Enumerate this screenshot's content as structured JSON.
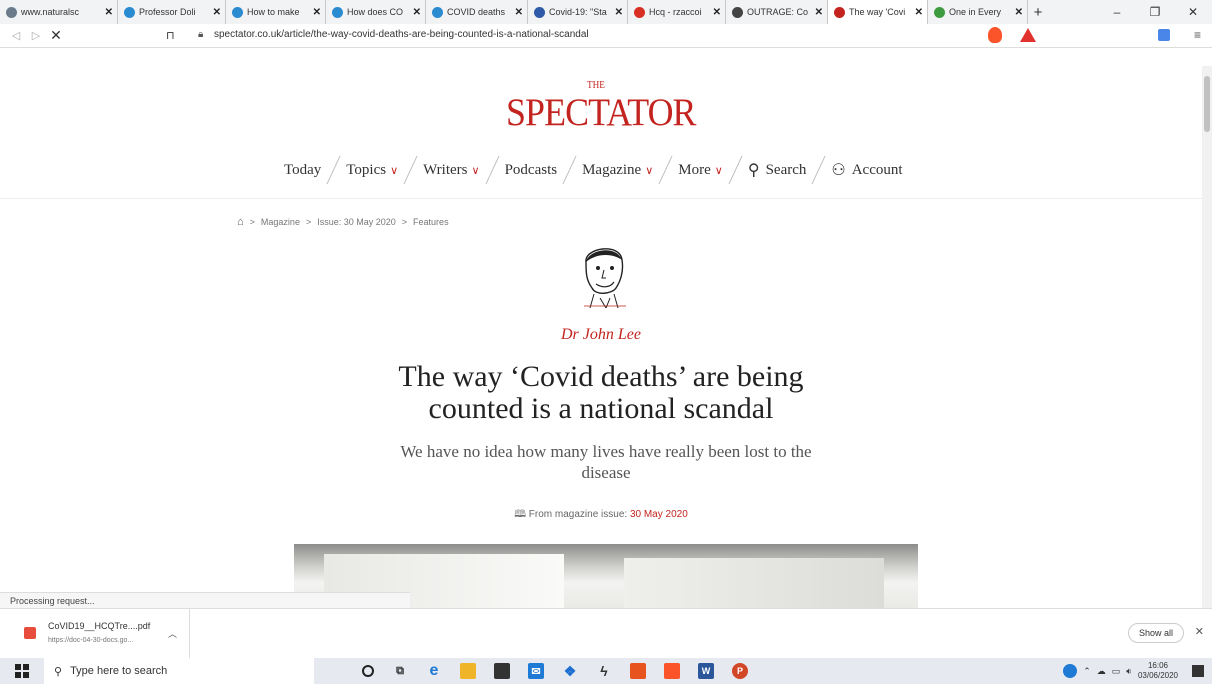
{
  "tabs": [
    {
      "title": "www.naturalsc",
      "icon": "globe-icon",
      "color": "#6b7b8c",
      "active": false,
      "width": 118
    },
    {
      "title": "Professor Doli",
      "icon": "wordpress-icon",
      "color": "#2a8bd1",
      "active": false,
      "width": 108
    },
    {
      "title": "How to make",
      "icon": "wordpress-icon",
      "color": "#2a8bd1",
      "active": false,
      "width": 100
    },
    {
      "title": "How does CO",
      "icon": "wordpress-icon",
      "color": "#2a8bd1",
      "active": false,
      "width": 100
    },
    {
      "title": "COVID deaths",
      "icon": "wordpress-icon",
      "color": "#2a8bd1",
      "active": false,
      "width": 102
    },
    {
      "title": "Covid-19: \"Sta",
      "icon": "bmj-icon",
      "color": "#2f5aa8",
      "active": false,
      "width": 100
    },
    {
      "title": "Hcq - rzaccoi",
      "icon": "gmail-icon",
      "color": "#d93025",
      "active": false,
      "width": 98
    },
    {
      "title": "OUTRAGE: Co",
      "icon": "frn-icon",
      "color": "#444444",
      "active": false,
      "width": 102
    },
    {
      "title": "The way 'Covi",
      "icon": "spectator-icon",
      "color": "#c3241f",
      "active": true,
      "width": 100
    },
    {
      "title": "One in Every",
      "icon": "globe-icon",
      "color": "#3f9b3f",
      "active": false,
      "width": 100
    }
  ],
  "window_controls": {
    "minimize": "–",
    "maximize": "❐",
    "close": "✕"
  },
  "address": {
    "url": "spectator.co.uk/article/the-way-covid-deaths-are-being-counted-is-a-national-scandal"
  },
  "site": {
    "logo_small": "THE",
    "logo": "SPECTATOR"
  },
  "menu": [
    {
      "label": "Today",
      "chevron": false,
      "name": "nav-today"
    },
    {
      "label": "Topics",
      "chevron": true,
      "name": "nav-topics"
    },
    {
      "label": "Writers",
      "chevron": true,
      "name": "nav-writers"
    },
    {
      "label": "Podcasts",
      "chevron": false,
      "name": "nav-podcasts"
    },
    {
      "label": "Magazine",
      "chevron": true,
      "name": "nav-magazine"
    },
    {
      "label": "More",
      "chevron": true,
      "name": "nav-more"
    },
    {
      "label": "Search",
      "chevron": false,
      "name": "nav-search",
      "icon": "search-icon"
    },
    {
      "label": "Account",
      "chevron": false,
      "name": "nav-account",
      "icon": "user-icon"
    }
  ],
  "breadcrumb": [
    "Magazine",
    "Issue: 30 May 2020",
    "Features"
  ],
  "article": {
    "author": "Dr John Lee",
    "headline": "The way ‘Covid deaths’ are being counted is a national scandal",
    "subhead": "We have no idea how many lives have really been lost to the disease",
    "issue_prefix": "From magazine issue:",
    "issue_date": "30 May 2020"
  },
  "status_text": "Processing request...",
  "download": {
    "file": "CoVID19__HCQTre....pdf",
    "source": "https://doc-04-30-docs.go...",
    "show_all": "Show all"
  },
  "taskbar": {
    "search_placeholder": "Type here to search",
    "time": "16:06",
    "date": "03/06/2020"
  },
  "colors": {
    "brand": "#c3241f"
  }
}
